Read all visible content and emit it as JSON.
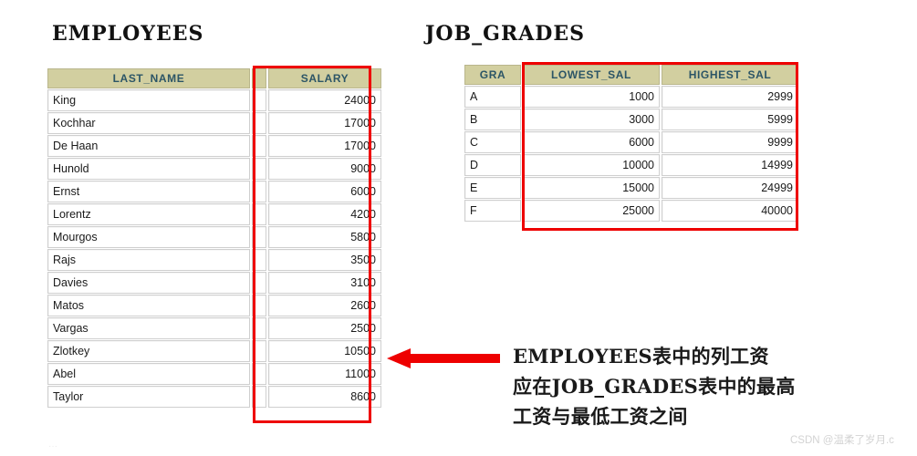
{
  "employees": {
    "title": "EMPLOYEES",
    "columns": [
      "LAST_NAME",
      "SALARY"
    ],
    "rows": [
      {
        "last_name": "King",
        "salary": "24000"
      },
      {
        "last_name": "Kochhar",
        "salary": "17000"
      },
      {
        "last_name": "De Haan",
        "salary": "17000"
      },
      {
        "last_name": "Hunold",
        "salary": "9000"
      },
      {
        "last_name": "Ernst",
        "salary": "6000"
      },
      {
        "last_name": "Lorentz",
        "salary": "4200"
      },
      {
        "last_name": "Mourgos",
        "salary": "5800"
      },
      {
        "last_name": "Rajs",
        "salary": "3500"
      },
      {
        "last_name": "Davies",
        "salary": "3100"
      },
      {
        "last_name": "Matos",
        "salary": "2600"
      },
      {
        "last_name": "Vargas",
        "salary": "2500"
      },
      {
        "last_name": "Zlotkey",
        "salary": "10500"
      },
      {
        "last_name": "Abel",
        "salary": "11000"
      },
      {
        "last_name": "Taylor",
        "salary": "8600"
      }
    ]
  },
  "job_grades": {
    "title": "JOB_GRADES",
    "columns": [
      "GRA",
      "LOWEST_SAL",
      "HIGHEST_SAL"
    ],
    "rows": [
      {
        "grade": "A",
        "lowest_sal": "1000",
        "highest_sal": "2999"
      },
      {
        "grade": "B",
        "lowest_sal": "3000",
        "highest_sal": "5999"
      },
      {
        "grade": "C",
        "lowest_sal": "6000",
        "highest_sal": "9999"
      },
      {
        "grade": "D",
        "lowest_sal": "10000",
        "highest_sal": "14999"
      },
      {
        "grade": "E",
        "lowest_sal": "15000",
        "highest_sal": "24999"
      },
      {
        "grade": "F",
        "lowest_sal": "25000",
        "highest_sal": "40000"
      }
    ]
  },
  "annotation": {
    "line1": "EMPLOYEES表中的列工资",
    "line2": "应在JOB_GRADES表中的最高",
    "line3": "工资与最低工资之间"
  },
  "watermark": {
    "text": "CSDN @温柔了岁月.c"
  },
  "colors": {
    "header_bg": "#d2cfa0",
    "header_text": "#2c5566",
    "highlight": "#ee0000",
    "cell_bg": "#ffffff",
    "cell_text": "#1a1a1a",
    "watermark": "#d3d3d3"
  }
}
